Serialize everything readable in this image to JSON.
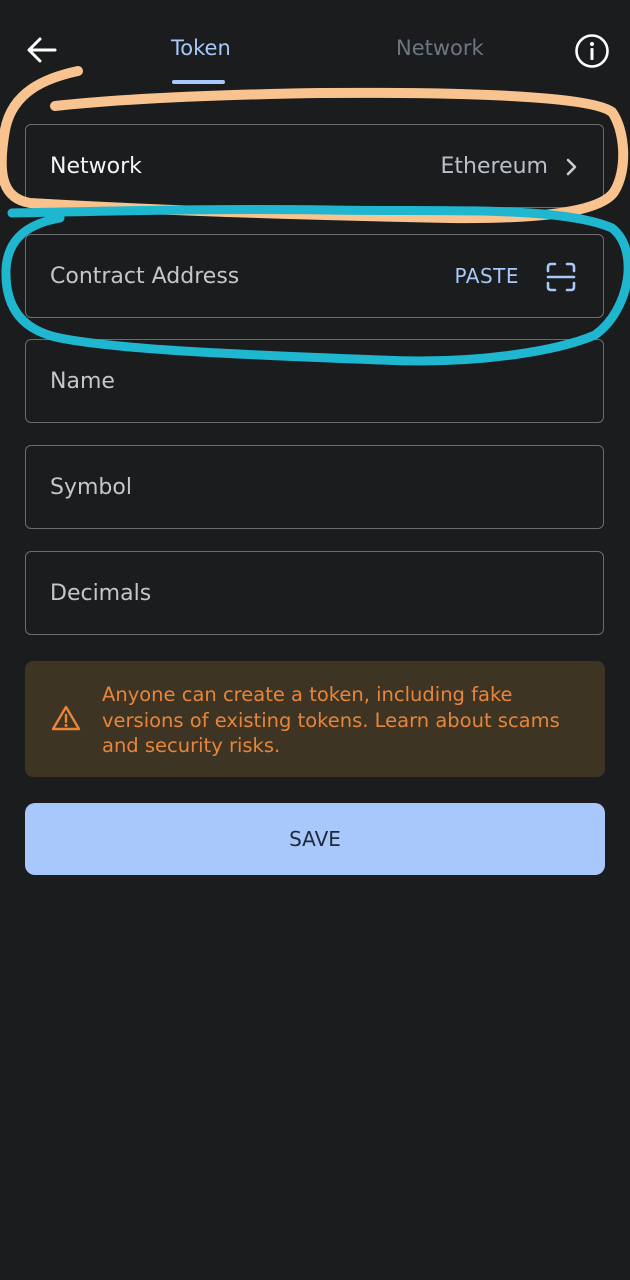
{
  "header": {
    "tabs": [
      {
        "label": "Token",
        "active": true
      },
      {
        "label": "Network",
        "active": false
      }
    ]
  },
  "form": {
    "network": {
      "label": "Network",
      "value": "Ethereum"
    },
    "contract_address": {
      "placeholder": "Contract Address",
      "paste_label": "PASTE"
    },
    "name": {
      "placeholder": "Name"
    },
    "symbol": {
      "placeholder": "Symbol"
    },
    "decimals": {
      "placeholder": "Decimals"
    }
  },
  "warning": {
    "text": "Anyone can create a token, including fake versions of existing tokens. Learn about scams and security risks."
  },
  "actions": {
    "save_label": "SAVE"
  },
  "icons": {
    "back": "arrow-left-icon",
    "info": "info-circle-icon",
    "chevron": "chevron-right-icon",
    "scan": "qr-scan-icon",
    "warning": "warning-triangle-icon"
  },
  "colors": {
    "background": "#1b1c1e",
    "accent": "#a8c7fa",
    "warning_bg": "#3e3424",
    "warning_text": "#e8853a",
    "annotation_orange": "#f9c38f",
    "annotation_teal": "#1fb7d0"
  }
}
